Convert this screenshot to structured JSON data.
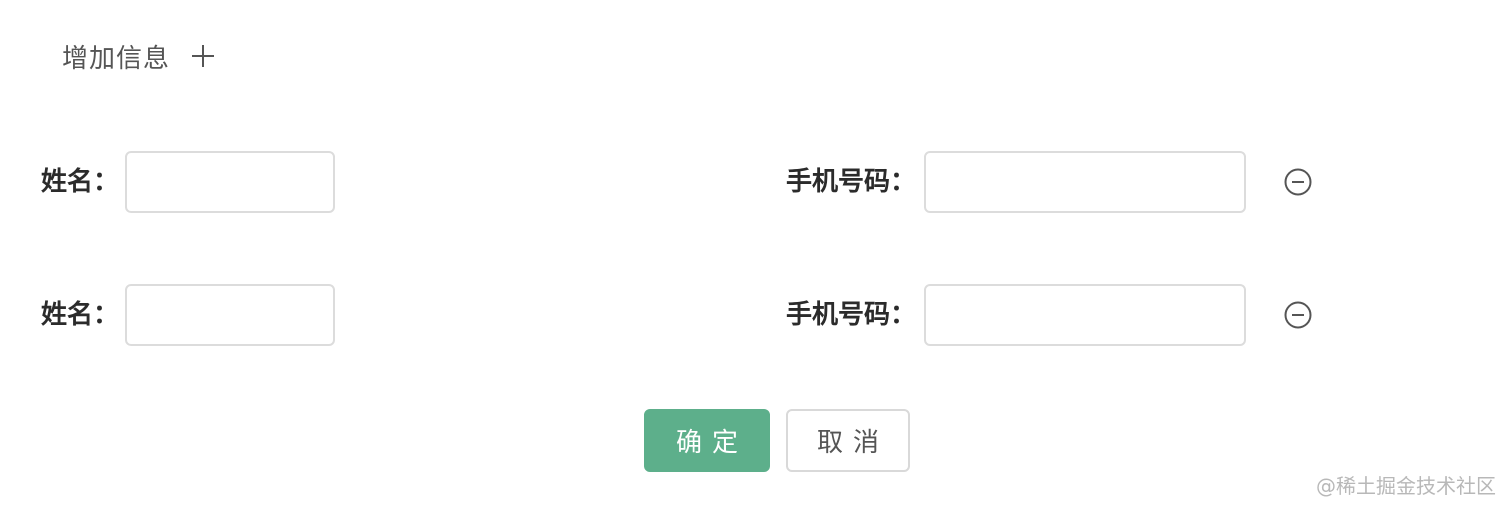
{
  "header": {
    "add_label": "增加信息",
    "add_icon": "plus-icon"
  },
  "form": {
    "rows": [
      {
        "name_label": "姓名：",
        "name_value": "",
        "phone_label": "手机号码：",
        "phone_value": "",
        "remove_icon": "minus-circle-icon"
      },
      {
        "name_label": "姓名：",
        "name_value": "",
        "phone_label": "手机号码：",
        "phone_value": "",
        "remove_icon": "minus-circle-icon"
      }
    ]
  },
  "actions": {
    "confirm_label": "确定",
    "cancel_label": "取消",
    "confirm_color": "#5daf8b"
  },
  "watermark": "@稀土掘金技术社区"
}
